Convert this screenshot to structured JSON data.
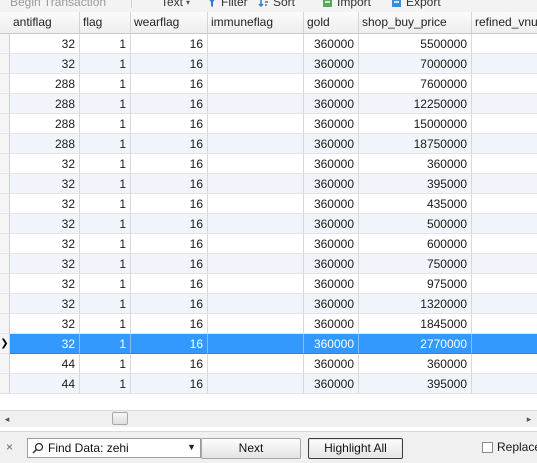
{
  "toolbar": {
    "begin_transaction": "Begin Transaction",
    "text": "Text",
    "filter": "Filter",
    "sort": "Sort",
    "import": "Import",
    "export": "Export"
  },
  "columns": [
    "antiflag",
    "flag",
    "wearflag",
    "immuneflag",
    "gold",
    "shop_buy_price",
    "refined_vnum"
  ],
  "rows": [
    {
      "antiflag": "32",
      "flag": "1",
      "wearflag": "16",
      "immuneflag": "",
      "gold": "360000",
      "shop_buy_price": "5500000",
      "refined_vnum": ""
    },
    {
      "antiflag": "32",
      "flag": "1",
      "wearflag": "16",
      "immuneflag": "",
      "gold": "360000",
      "shop_buy_price": "7000000",
      "refined_vnum": ""
    },
    {
      "antiflag": "288",
      "flag": "1",
      "wearflag": "16",
      "immuneflag": "",
      "gold": "360000",
      "shop_buy_price": "7600000",
      "refined_vnum": ""
    },
    {
      "antiflag": "288",
      "flag": "1",
      "wearflag": "16",
      "immuneflag": "",
      "gold": "360000",
      "shop_buy_price": "12250000",
      "refined_vnum": ""
    },
    {
      "antiflag": "288",
      "flag": "1",
      "wearflag": "16",
      "immuneflag": "",
      "gold": "360000",
      "shop_buy_price": "15000000",
      "refined_vnum": ""
    },
    {
      "antiflag": "288",
      "flag": "1",
      "wearflag": "16",
      "immuneflag": "",
      "gold": "360000",
      "shop_buy_price": "18750000",
      "refined_vnum": ""
    },
    {
      "antiflag": "32",
      "flag": "1",
      "wearflag": "16",
      "immuneflag": "",
      "gold": "360000",
      "shop_buy_price": "360000",
      "refined_vnum": ""
    },
    {
      "antiflag": "32",
      "flag": "1",
      "wearflag": "16",
      "immuneflag": "",
      "gold": "360000",
      "shop_buy_price": "395000",
      "refined_vnum": ""
    },
    {
      "antiflag": "32",
      "flag": "1",
      "wearflag": "16",
      "immuneflag": "",
      "gold": "360000",
      "shop_buy_price": "435000",
      "refined_vnum": ""
    },
    {
      "antiflag": "32",
      "flag": "1",
      "wearflag": "16",
      "immuneflag": "",
      "gold": "360000",
      "shop_buy_price": "500000",
      "refined_vnum": ""
    },
    {
      "antiflag": "32",
      "flag": "1",
      "wearflag": "16",
      "immuneflag": "",
      "gold": "360000",
      "shop_buy_price": "600000",
      "refined_vnum": ""
    },
    {
      "antiflag": "32",
      "flag": "1",
      "wearflag": "16",
      "immuneflag": "",
      "gold": "360000",
      "shop_buy_price": "750000",
      "refined_vnum": ""
    },
    {
      "antiflag": "32",
      "flag": "1",
      "wearflag": "16",
      "immuneflag": "",
      "gold": "360000",
      "shop_buy_price": "975000",
      "refined_vnum": ""
    },
    {
      "antiflag": "32",
      "flag": "1",
      "wearflag": "16",
      "immuneflag": "",
      "gold": "360000",
      "shop_buy_price": "1320000",
      "refined_vnum": ""
    },
    {
      "antiflag": "32",
      "flag": "1",
      "wearflag": "16",
      "immuneflag": "",
      "gold": "360000",
      "shop_buy_price": "1845000",
      "refined_vnum": ""
    },
    {
      "antiflag": "32",
      "flag": "1",
      "wearflag": "16",
      "immuneflag": "",
      "gold": "360000",
      "shop_buy_price": "2770000",
      "refined_vnum": ""
    },
    {
      "antiflag": "44",
      "flag": "1",
      "wearflag": "16",
      "immuneflag": "",
      "gold": "360000",
      "shop_buy_price": "360000",
      "refined_vnum": ""
    },
    {
      "antiflag": "44",
      "flag": "1",
      "wearflag": "16",
      "immuneflag": "",
      "gold": "360000",
      "shop_buy_price": "395000",
      "refined_vnum": ""
    }
  ],
  "selected_row": 15,
  "row_indicator": "❯",
  "scroll": {
    "left_arrow": "◂",
    "right_arrow": "▸"
  },
  "findbar": {
    "close": "×",
    "find_value": "Find Data: zehi",
    "dropdown_arrow": "▼",
    "next_label": "Next",
    "highlight_all_label": "Highlight All",
    "replace_label": "Replace"
  },
  "colors": {
    "selection": "#3399ff",
    "alt_row": "#f1f5fb"
  }
}
